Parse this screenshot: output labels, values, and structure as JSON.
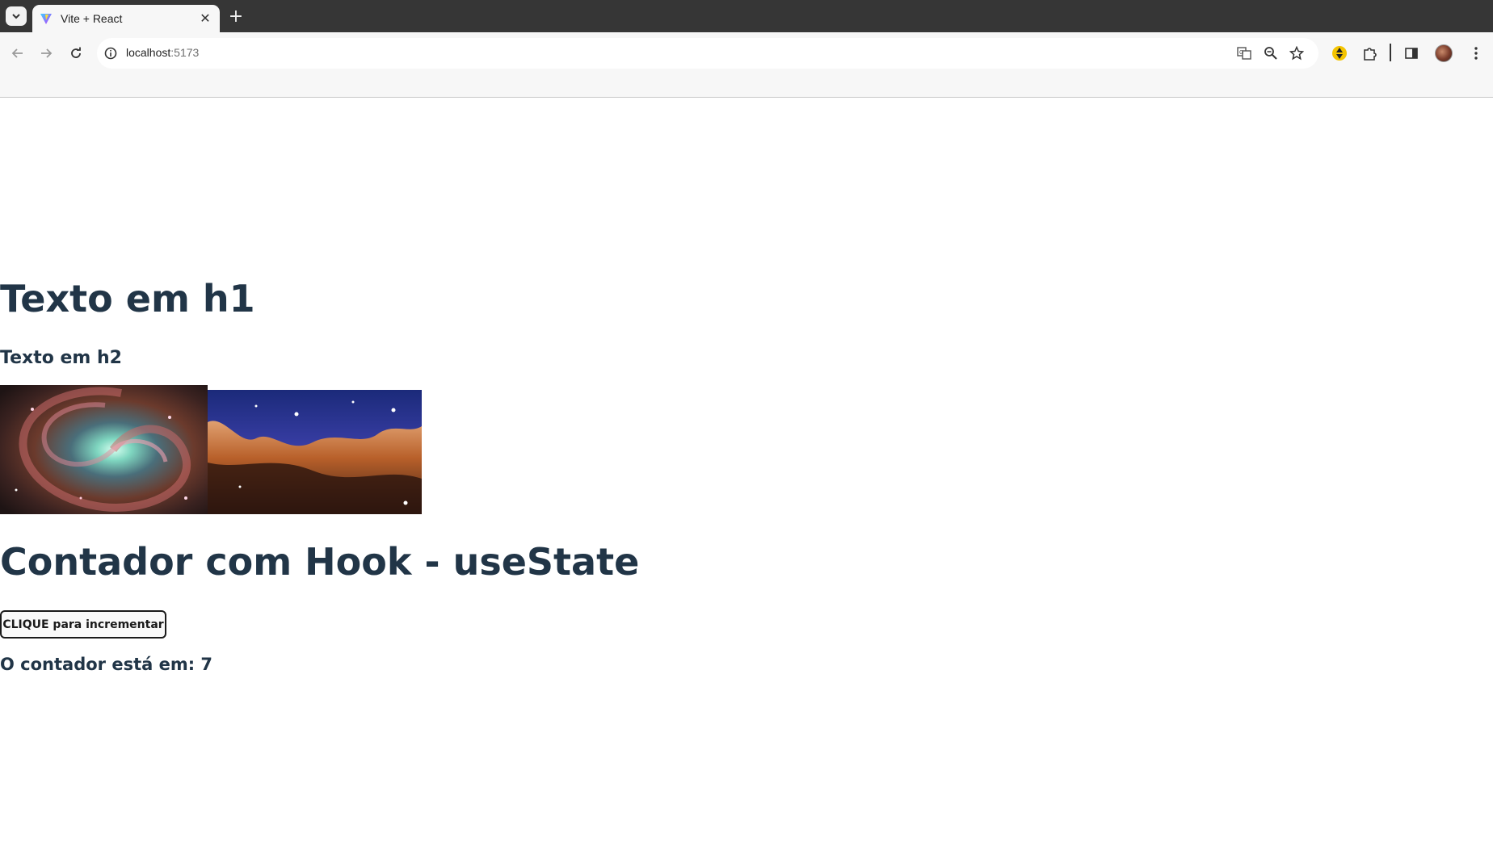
{
  "browser": {
    "tab_title": "Vite + React",
    "url_host": "localhost",
    "url_port": ":5173"
  },
  "page": {
    "h1": "Texto em h1",
    "h2": "Texto em h2",
    "images": [
      {
        "alt": "galaxy",
        "description_icon": "spiral-galaxy-image"
      },
      {
        "alt": "nebula",
        "description_icon": "cosmic-cliffs-image"
      }
    ],
    "counter_title": "Contador com Hook - useState",
    "button_label": "CLIQUE para incrementar",
    "counter_prefix": "O contador está em: ",
    "counter_value": 7
  },
  "colors": {
    "heading": "#213547",
    "chrome_dark": "#363636",
    "toolbar": "#f7f7f7"
  }
}
